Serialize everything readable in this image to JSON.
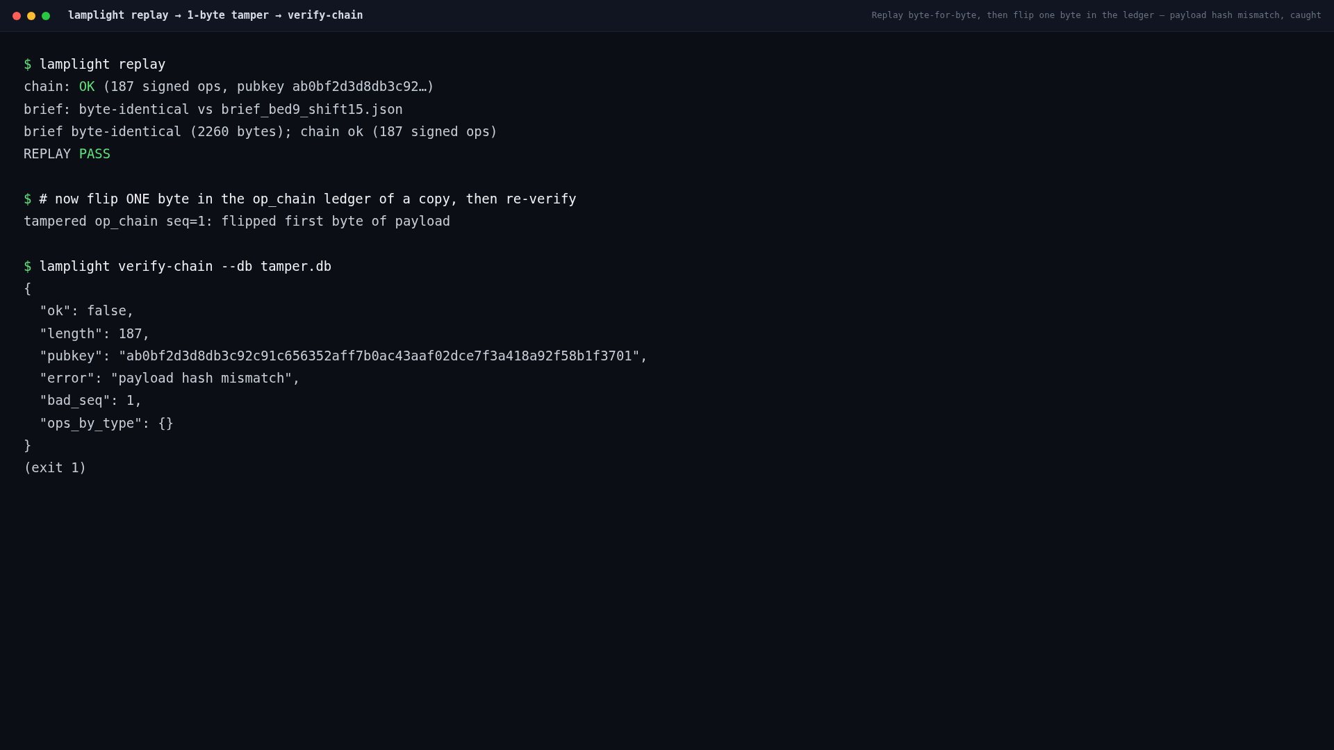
{
  "window": {
    "title": "lamplight replay → 1-byte tamper → verify-chain",
    "subtitle": "Replay byte-for-byte, then flip one byte in the ledger — payload hash mismatch, caught"
  },
  "lines": [
    {
      "kind": "command",
      "prompt": "$",
      "text": "lamplight replay"
    },
    {
      "kind": "output",
      "segments": [
        {
          "text": "chain: ",
          "color": "#c9cfd9"
        },
        {
          "text": "OK",
          "color": "#5ee27a"
        },
        {
          "text": " (187 signed ops, pubkey ab0bf2d3d8db3c92…)",
          "color": "#c9cfd9"
        }
      ]
    },
    {
      "kind": "output",
      "segments": [
        {
          "text": "brief: byte-identical vs brief_bed9_shift15.json",
          "color": "#c9cfd9"
        }
      ]
    },
    {
      "kind": "output",
      "segments": [
        {
          "text": "brief byte-identical (2260 bytes); chain ok (187 signed ops)",
          "color": "#c9cfd9"
        }
      ]
    },
    {
      "kind": "output",
      "segments": [
        {
          "text": "REPLAY ",
          "color": "#c9cfd9"
        },
        {
          "text": "PASS",
          "color": "#5ee27a"
        }
      ]
    },
    {
      "kind": "blank"
    },
    {
      "kind": "command",
      "prompt": "$",
      "text": "# now flip ONE byte in the op_chain ledger of a copy, then re-verify"
    },
    {
      "kind": "output",
      "segments": [
        {
          "text": "tampered op_chain seq=1: flipped first byte of payload",
          "color": "#c9cfd9"
        }
      ]
    },
    {
      "kind": "blank"
    },
    {
      "kind": "command",
      "prompt": "$",
      "text": "lamplight verify-chain --db tamper.db"
    },
    {
      "kind": "output",
      "segments": [
        {
          "text": "{",
          "color": "#c9cfd9"
        }
      ]
    },
    {
      "kind": "output",
      "segments": [
        {
          "text": "  \"ok\": false,",
          "color": "#c9cfd9"
        }
      ]
    },
    {
      "kind": "output",
      "segments": [
        {
          "text": "  \"length\": 187,",
          "color": "#c9cfd9"
        }
      ]
    },
    {
      "kind": "output",
      "segments": [
        {
          "text": "  \"pubkey\": \"ab0bf2d3d8db3c92c91c656352aff7b0ac43aaf02dce7f3a418a92f58b1f3701\",",
          "color": "#c9cfd9"
        }
      ]
    },
    {
      "kind": "output",
      "segments": [
        {
          "text": "  \"error\": \"payload hash mismatch\",",
          "color": "#c9cfd9"
        }
      ]
    },
    {
      "kind": "output",
      "segments": [
        {
          "text": "  \"bad_seq\": 1,",
          "color": "#c9cfd9"
        }
      ]
    },
    {
      "kind": "output",
      "segments": [
        {
          "text": "  \"ops_by_type\": {}",
          "color": "#c9cfd9"
        }
      ]
    },
    {
      "kind": "output",
      "segments": [
        {
          "text": "}",
          "color": "#c9cfd9"
        }
      ]
    },
    {
      "kind": "output",
      "segments": [
        {
          "text": "(exit 1)",
          "color": "#c9cfd9"
        }
      ]
    }
  ]
}
